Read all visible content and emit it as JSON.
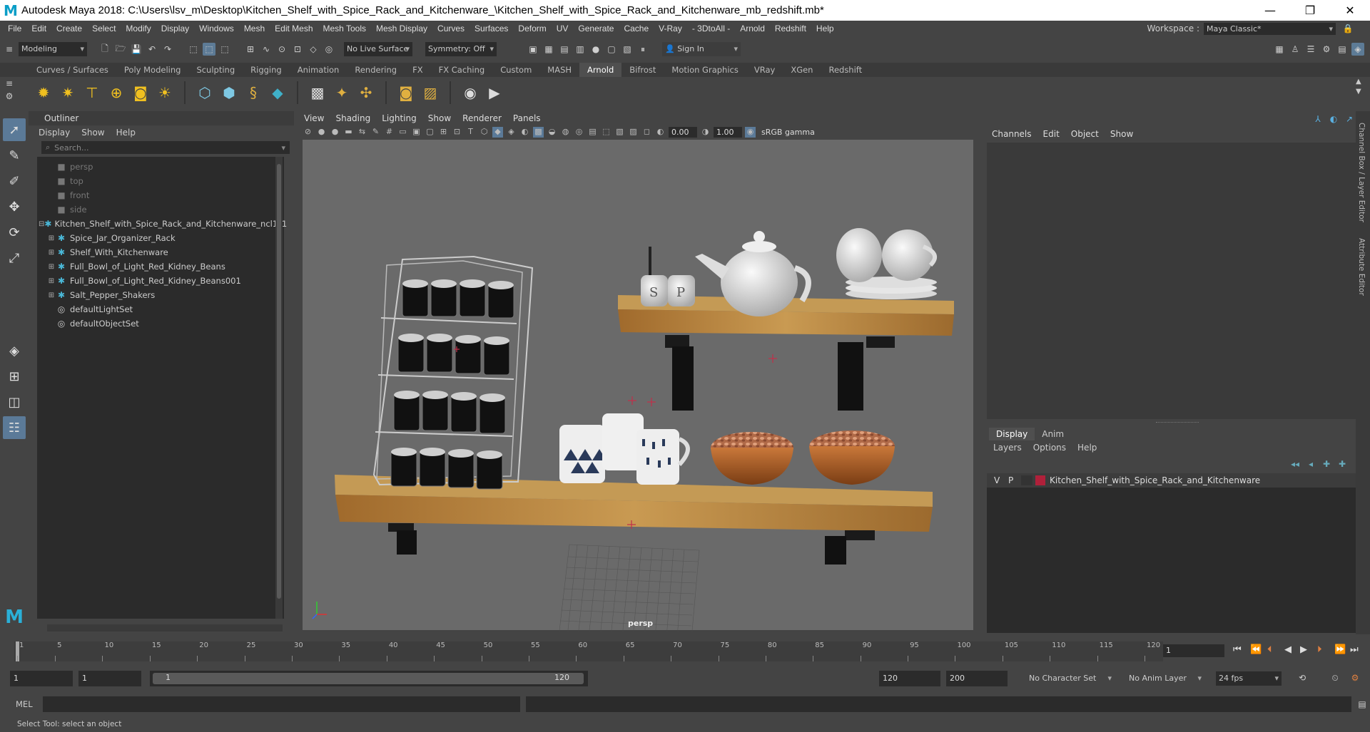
{
  "window": {
    "title": "Autodesk Maya 2018: C:\\Users\\lsv_m\\Desktop\\Kitchen_Shelf_with_Spice_Rack_and_Kitchenware_\\Kitchen_Shelf_with_Spice_Rack_and_Kitchenware_mb_redshift.mb*",
    "minimize": "—",
    "restore": "❐",
    "close": "✕"
  },
  "menubar": {
    "items": [
      "File",
      "Edit",
      "Create",
      "Select",
      "Modify",
      "Display",
      "Windows",
      "Mesh",
      "Edit Mesh",
      "Mesh Tools",
      "Mesh Display",
      "Curves",
      "Surfaces",
      "Deform",
      "UV",
      "Generate",
      "Cache",
      "V-Ray",
      "- 3DtoAll -",
      "Arnold",
      "Redshift",
      "Help"
    ],
    "workspace_label": "Workspace :",
    "workspace_value": "Maya Classic*"
  },
  "statusline": {
    "mode": "Modeling",
    "live_surface": "No Live Surface",
    "symmetry": "Symmetry: Off",
    "sign_in": "Sign In"
  },
  "shelf": {
    "tabs": [
      "Curves / Surfaces",
      "Poly Modeling",
      "Sculpting",
      "Rigging",
      "Animation",
      "Rendering",
      "FX",
      "FX Caching",
      "Custom",
      "MASH",
      "Arnold",
      "Bifrost",
      "Motion Graphics",
      "VRay",
      "XGen",
      "Redshift"
    ],
    "active_tab": "Arnold"
  },
  "outliner": {
    "title": "Outliner",
    "menu": [
      "Display",
      "Show",
      "Help"
    ],
    "search_placeholder": "Search...",
    "cameras": [
      "persp",
      "top",
      "front",
      "side"
    ],
    "group": "Kitchen_Shelf_with_Spice_Rack_and_Kitchenware_ncl1_1",
    "children": [
      "Spice_Jar_Organizer_Rack",
      "Shelf_With_Kitchenware",
      "Full_Bowl_of_Light_Red_Kidney_Beans",
      "Full_Bowl_of_Light_Red_Kidney_Beans001",
      "Salt_Pepper_Shakers"
    ],
    "sets": [
      "defaultLightSet",
      "defaultObjectSet"
    ]
  },
  "viewport": {
    "menu": [
      "View",
      "Shading",
      "Lighting",
      "Show",
      "Renderer",
      "Panels"
    ],
    "exposure": "0.00",
    "gamma": "1.00",
    "colorspace": "sRGB gamma",
    "camera_label": "persp"
  },
  "channelbox": {
    "menu": [
      "Channels",
      "Edit",
      "Object",
      "Show"
    ]
  },
  "layereditor": {
    "tabs": [
      "Display",
      "Anim"
    ],
    "menu": [
      "Layers",
      "Options",
      "Help"
    ],
    "layer": {
      "v": "V",
      "p": "P",
      "name": "Kitchen_Shelf_with_Spice_Rack_and_Kitchenware",
      "color": "#b0203a"
    }
  },
  "sidetabs": [
    "Channel Box / Layer Editor",
    "Attribute Editor"
  ],
  "timeline": {
    "ticks": [
      "1",
      "5",
      "10",
      "15",
      "20",
      "25",
      "30",
      "35",
      "40",
      "45",
      "50",
      "55",
      "60",
      "65",
      "70",
      "75",
      "80",
      "85",
      "90",
      "95",
      "100",
      "105",
      "110",
      "115",
      "120"
    ],
    "current_frame": "1"
  },
  "range": {
    "start": "1",
    "playback_start": "1",
    "slider_start": "1",
    "slider_end": "120",
    "playback_end": "120",
    "end": "200",
    "character_set": "No Character Set",
    "anim_layer": "No Anim Layer",
    "fps": "24 fps"
  },
  "command": {
    "lang": "MEL"
  },
  "help_line": "Select Tool: select an object"
}
